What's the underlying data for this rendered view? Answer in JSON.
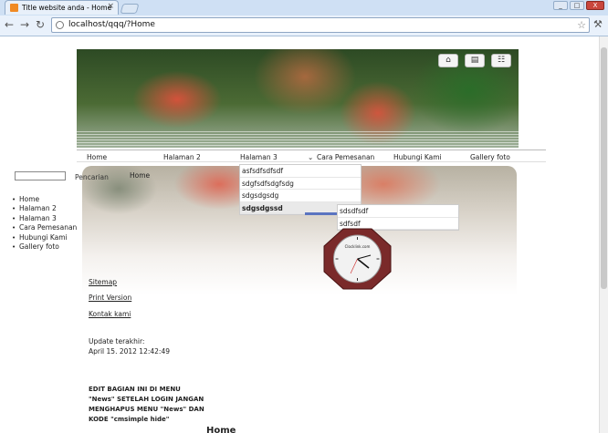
{
  "browser": {
    "tab_title": "Title website anda - Home",
    "tab_close": "×",
    "url": "localhost/qqq/?Home",
    "back_icon": "arrow-left-icon",
    "forward_icon": "arrow-right-icon",
    "reload_icon": "reload-icon",
    "star_icon": "star-icon",
    "wrench_icon": "wrench-icon",
    "window_buttons": [
      "_",
      "□",
      "X"
    ]
  },
  "header": {
    "buttons": [
      "home-icon",
      "bookmark-icon",
      "sitemap-icon"
    ]
  },
  "menu": {
    "items": [
      "Home",
      "Halaman 2",
      "Halaman 3",
      "Cara Pemesanan",
      "Hubungi Kami",
      "Gallery foto"
    ],
    "dropdown": [
      "asfsdfsdfsdf",
      "sdgfsdfsdgfsdg",
      "sdgsdgsdg",
      "sdgsdgssd"
    ],
    "subdropdown": [
      "sdsdfsdf",
      "sdfsdf"
    ]
  },
  "sidebar": {
    "search_label": "Pencarian",
    "nav": [
      "Home",
      "Halaman 2",
      "Halaman 3",
      "Cara Pemesanan",
      "Hubungi Kami",
      "Gallery foto"
    ],
    "sitemap": "Sitemap",
    "print": "Print Version",
    "contact": "Kontak kami",
    "update_label": "Update terakhir:",
    "update_date": "April 15. 2012 12:42:49",
    "note": "EDIT BAGIAN INI DI MENU \"News\" SETELAH LOGIN JANGAN MENGHAPUS MENU \"News\" DAN KODE \"cmsimple hide\""
  },
  "main": {
    "breadcrumb": "Home",
    "heading": "Home"
  },
  "clock": {
    "brand": "Clocklink.com"
  },
  "colors": {
    "accent": "#5a74c0",
    "clock_frame": "#7a2a2a"
  }
}
